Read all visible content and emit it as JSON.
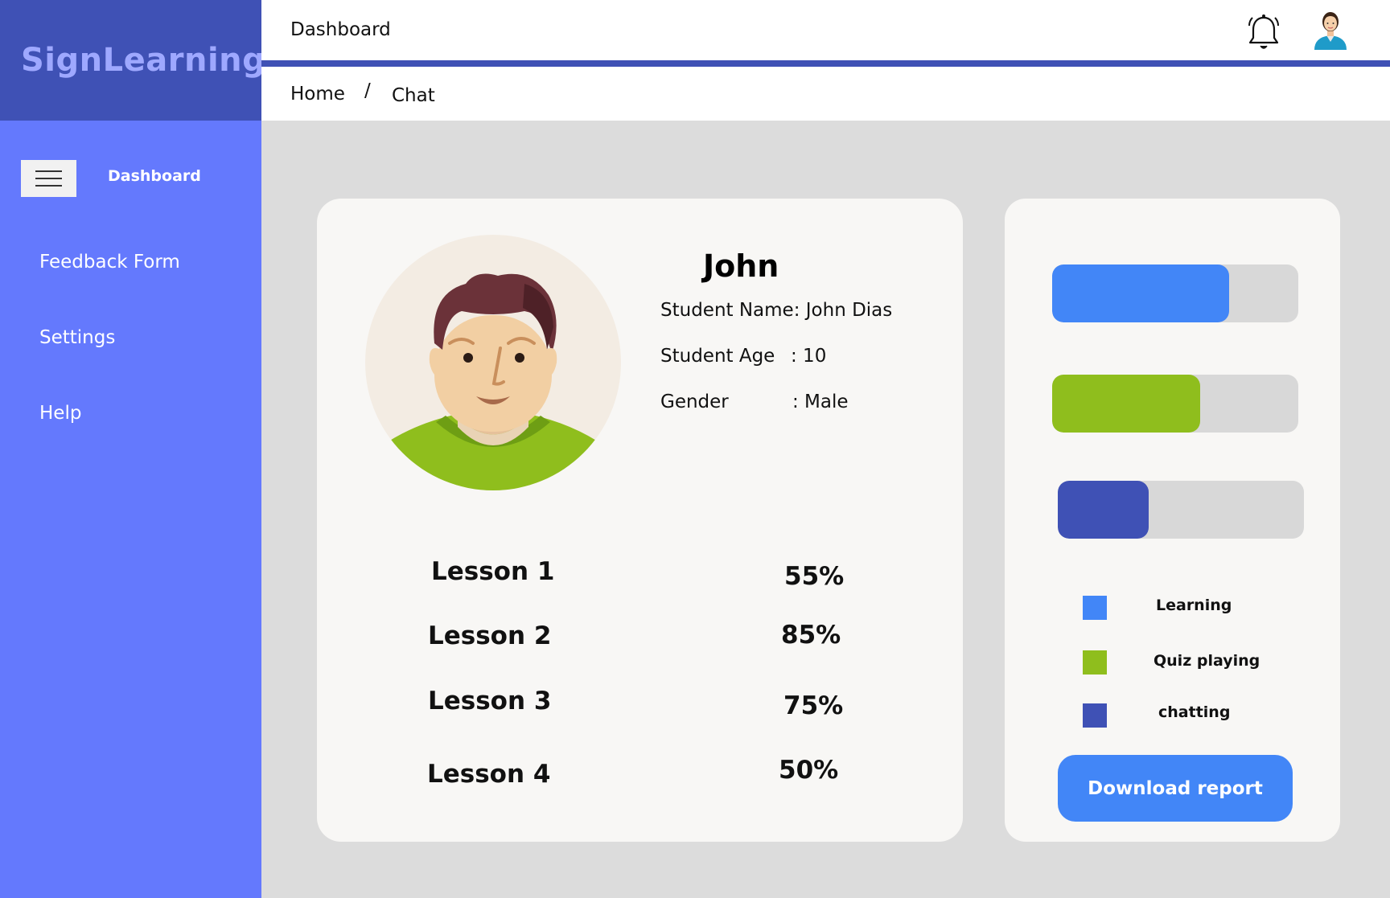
{
  "app": {
    "brand": "SignLearning"
  },
  "header": {
    "title": "Dashboard"
  },
  "breadcrumb": {
    "home": "Home",
    "separator": "/",
    "current": "Chat"
  },
  "sidebar": {
    "dashboard_label": "Dashboard",
    "items": [
      {
        "label": "Feedback Form"
      },
      {
        "label": "Settings"
      },
      {
        "label": "Help"
      }
    ]
  },
  "profile": {
    "name": "John",
    "fields": [
      {
        "label": "Student Name: John Dias",
        "value": ""
      },
      {
        "label": "Student Age",
        "value": ": 10"
      },
      {
        "label": "Gender",
        "value": ": Male"
      }
    ],
    "lessons": [
      {
        "label": "Lesson 1",
        "score": "55%"
      },
      {
        "label": "Lesson 2",
        "score": "85%"
      },
      {
        "label": "Lesson 3",
        "score": "75%"
      },
      {
        "label": "Lesson 4",
        "score": "50%"
      }
    ]
  },
  "activity": {
    "bars": [
      {
        "name": "Learning",
        "fraction": 0.72,
        "color": "#4286f7"
      },
      {
        "name": "Quiz playing",
        "fraction": 0.6,
        "color": "#8fbe1d"
      },
      {
        "name": "chatting",
        "fraction": 0.37,
        "color": "#3f51b5"
      }
    ],
    "legend": [
      {
        "label": "Learning",
        "color": "#4286f7"
      },
      {
        "label": "Quiz playing",
        "color": "#8fbe1d"
      },
      {
        "label": "chatting",
        "color": "#3f51b5"
      }
    ],
    "download_label": "Download report"
  },
  "icons": {
    "notifications": "bell-icon",
    "user": "user-avatar-icon",
    "menu": "hamburger-icon"
  },
  "colors": {
    "brand_dark": "#3f51b5",
    "sidebar": "#6479fd",
    "accent_blue": "#4286f7",
    "accent_green": "#8fbe1d"
  }
}
